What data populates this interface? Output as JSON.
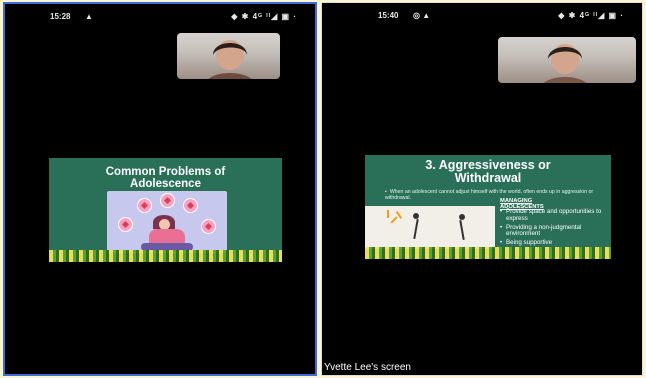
{
  "left_phone": {
    "status_time": "15:28",
    "status_left_icons": "▲",
    "status_right_icons": "◆ ✱ 4ᴳ ᴵᴵ◢ ▣ ·",
    "slide": {
      "title": "Common Problems of\nAdolescence"
    }
  },
  "right_phone": {
    "status_time": "15:40",
    "status_left_icons": "◎ ▲",
    "status_right_icons": "◆ ✱ 4ᴳ ᴵᴵ◢ ▣ ·",
    "slide": {
      "title": "3. Aggressiveness or\nWithdrawal",
      "bullet": "When an adolescent cannot adjust himself with the world, often ends up in aggression or withdrawal.",
      "managing_label_1": "MANAGING",
      "managing_label_2": "ADOLESCENTS",
      "tips": [
        "Provide space and opportunities to express",
        "Providing a non-judgmental environment",
        "Being supportive"
      ]
    },
    "caption": "Yvette Lee's screen"
  },
  "colors": {
    "slide_bg": "#2a7058",
    "phone_bg": "#000000",
    "page_bg": "#fff4d0",
    "left_border": "#3a6fd6"
  },
  "icons": {
    "video_tile": "video-thumbnail",
    "status": [
      "signal-icon",
      "battery-icon",
      "notification-icon"
    ]
  }
}
